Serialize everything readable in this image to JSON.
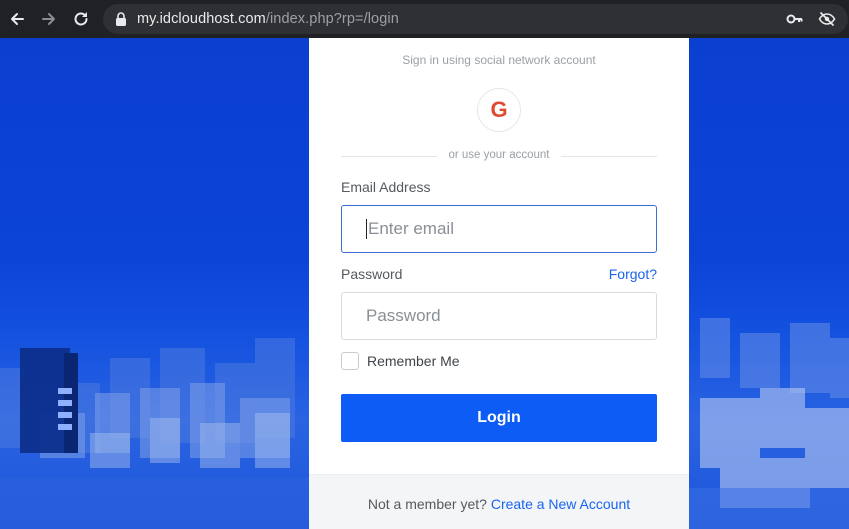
{
  "browser": {
    "url_host": "my.idcloudhost.com",
    "url_path": "/index.php?rp=/login"
  },
  "login": {
    "social_heading": "Sign in using social network account",
    "google_letter": "G",
    "divider_text": "or use your account",
    "email_label": "Email Address",
    "email_placeholder": "Enter email",
    "password_label": "Password",
    "forgot_link": "Forgot?",
    "password_placeholder": "Password",
    "remember_label": "Remember Me",
    "login_button": "Login",
    "not_member_text": "Not a member yet?",
    "create_account_link": "Create a New Account"
  },
  "colors": {
    "accent": "#0d5cf5",
    "background_blue": "#0c44d8"
  },
  "icons": {
    "back": "arrow-left-icon",
    "forward": "arrow-right-icon",
    "reload": "reload-icon",
    "lock": "lock-icon",
    "key": "key-icon",
    "tracking": "eye-off-icon"
  }
}
